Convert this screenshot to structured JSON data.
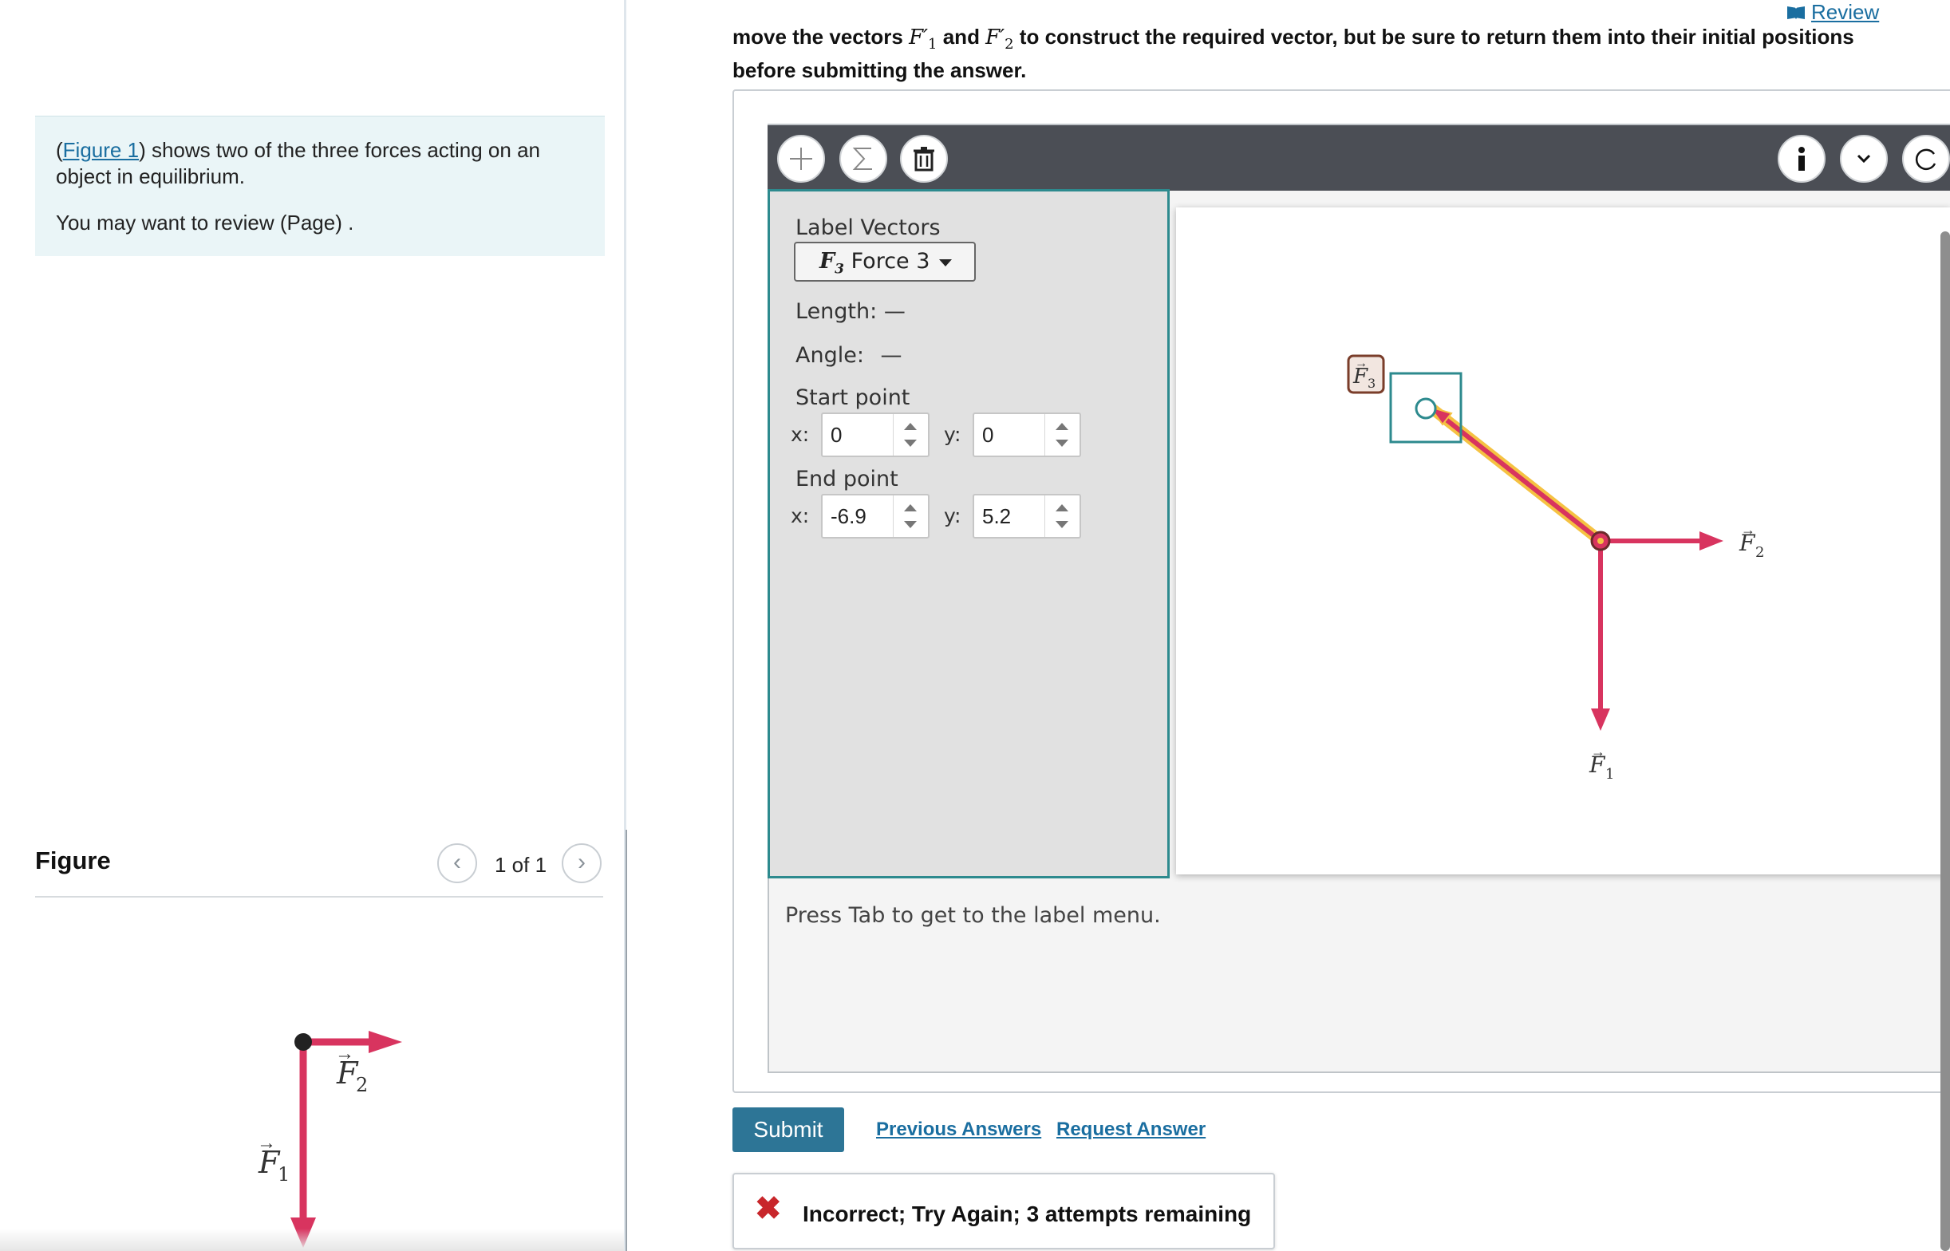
{
  "left": {
    "problem_link": "Figure 1",
    "problem_open": "(",
    "problem_text": ") shows two of the three forces acting on an object in equilibrium.",
    "review_text": "You may want to review (Page) .",
    "figure_title": "Figure",
    "figure_count": "1 of 1",
    "figure_vectors": {
      "f1": "F",
      "f1_sub": "1",
      "f2": "F",
      "f2_sub": "2"
    }
  },
  "header": {
    "review_label": "Review",
    "instructions_p1": "move the vectors ",
    "f1_prime": "F′",
    "f1_sub": "1",
    "instructions_and": " and ",
    "f2_prime": "F′",
    "f2_sub": "2",
    "instructions_p2": " to construct the required vector, but be sure to return them into their initial positions before submitting the answer."
  },
  "toolbar": {
    "add_icon": "plus-icon",
    "sum_icon": "sigma-icon",
    "delete_icon": "trash-icon",
    "info_icon": "info-icon",
    "expand_icon": "chevron-down-icon",
    "reset_icon": "reset-icon"
  },
  "label_panel": {
    "label_vectors": "Label Vectors",
    "selected_vector": "F",
    "selected_sub": "3",
    "selected_name": "Force 3",
    "length_label": "Length:",
    "length_value": "—",
    "angle_label": "Angle:",
    "angle_value": "—",
    "start_point_label": "Start point",
    "end_point_label": "End point",
    "x_label": "x:",
    "y_label": "y:",
    "start_x": "0",
    "start_y": "0",
    "end_x": "-6.9",
    "end_y": "5.2"
  },
  "canvas": {
    "f1_label": "F",
    "f1_sub": "1",
    "f2_label": "F",
    "f2_sub": "2",
    "f3_label": "F",
    "f3_sub": "3"
  },
  "hint": "Press Tab to get to the label menu.",
  "actions": {
    "submit": "Submit",
    "previous_answers": "Previous Answers",
    "request_answer": "Request Answer"
  },
  "feedback": {
    "icon": "x-icon",
    "message": "Incorrect; Try Again; 3 attempts remaining"
  },
  "colors": {
    "vector": "#d8345f",
    "highlight": "#f5c242",
    "accent": "#2d8a8e",
    "submit": "#2d7596",
    "error": "#c8262b"
  }
}
